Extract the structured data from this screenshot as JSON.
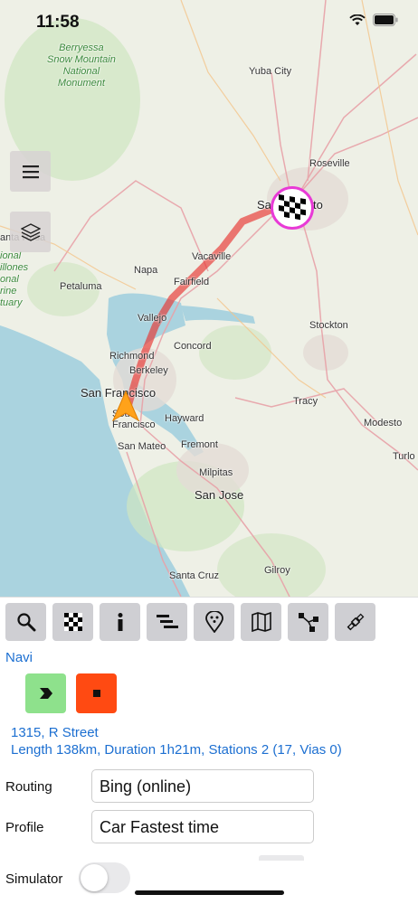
{
  "status_bar": {
    "time": "11:58"
  },
  "map": {
    "places": [
      {
        "name": "Berryessa Snow Mountain National Monument",
        "lines": [
          "Berryessa",
          "Snow Mountain",
          "National",
          "Monument"
        ]
      },
      {
        "name": "Yuba City"
      },
      {
        "name": "Roseville"
      },
      {
        "name": "Sacramento",
        "partial": "Sa",
        "partial_end": "to"
      },
      {
        "name": "Santa Rosa",
        "partial": "anta Rosa"
      },
      {
        "name": "Vacaville"
      },
      {
        "name": "Napa"
      },
      {
        "name": "Fairfield"
      },
      {
        "name": "Petaluma"
      },
      {
        "name": "Vallejo"
      },
      {
        "name": "Concord"
      },
      {
        "name": "Richmond"
      },
      {
        "name": "Berkeley"
      },
      {
        "name": "Stockton"
      },
      {
        "name": "San Francisco"
      },
      {
        "name": "South San Francisco",
        "lines": [
          "Sou",
          "Francisco"
        ]
      },
      {
        "name": "Hayward"
      },
      {
        "name": "Tracy"
      },
      {
        "name": "Modesto"
      },
      {
        "name": "Fremont"
      },
      {
        "name": "San Mateo"
      },
      {
        "name": "Milpitas"
      },
      {
        "name": "San Jose"
      },
      {
        "name": "Turlock",
        "partial": "Turlo"
      },
      {
        "name": "Santa Cruz"
      },
      {
        "name": "Gilroy"
      },
      {
        "name": "Estuary",
        "lines": [
          "ional",
          "illones",
          "onal",
          "rine",
          "tuary"
        ]
      }
    ],
    "menu_icon": "hamburger-icon",
    "layers_icon": "layers-icon",
    "start_marker_icon": "navigation-arrow-icon",
    "destination_marker_icon": "checkered-flag-icon",
    "route_color": "#e8332f"
  },
  "toolbar": {
    "buttons": [
      {
        "name": "search",
        "icon": "search-icon"
      },
      {
        "name": "destination",
        "icon": "checkered-flag-icon"
      },
      {
        "name": "info",
        "icon": "info-icon"
      },
      {
        "name": "route-list",
        "icon": "list-icon"
      },
      {
        "name": "poi",
        "icon": "poi-pin-icon"
      },
      {
        "name": "map",
        "icon": "map-icon"
      },
      {
        "name": "route-points",
        "icon": "route-nodes-icon"
      },
      {
        "name": "gps",
        "icon": "satellite-icon"
      }
    ]
  },
  "navi": {
    "title": "Navi",
    "start_color": "#8ee18c",
    "stop_color": "#ff4a12",
    "address": "1315, R Street",
    "summary": "Length 138km, Duration 1h21m, Stations 2 (17, Vias 0)"
  },
  "settings": {
    "routing_label": "Routing",
    "routing_value": "Bing (online)",
    "profile_label": "Profile",
    "profile_value": "Car Fastest time",
    "simulator_label": "Simulator",
    "simulator_on": false
  },
  "colors": {
    "link": "#1c6fd1",
    "tool_button": "#cfcfd3"
  }
}
